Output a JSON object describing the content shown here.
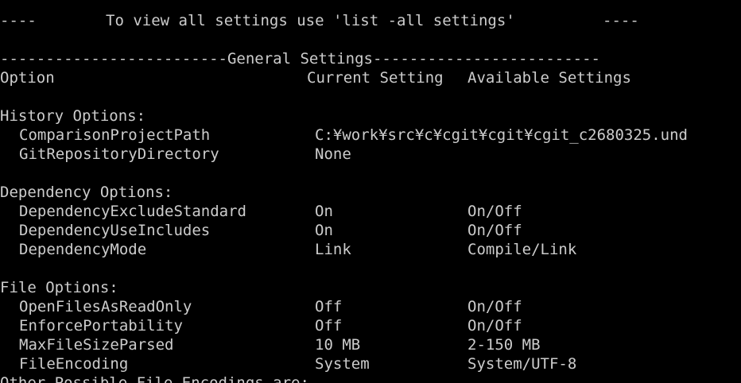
{
  "banner": {
    "left_dashes": "----",
    "message": "To view all settings use 'list -all settings'",
    "right_dashes": "----"
  },
  "section_rule": "-------------------------General Settings-------------------------",
  "columns": {
    "option": "Option",
    "current": "Current Setting",
    "available": "Available Settings"
  },
  "groups": [
    {
      "title": "History Options:",
      "rows": [
        {
          "option": "ComparisonProjectPath",
          "current": "C:¥work¥src¥c¥cgit¥cgit¥cgit_c2680325.und",
          "available": ""
        },
        {
          "option": "GitRepositoryDirectory",
          "current": "None",
          "available": ""
        }
      ]
    },
    {
      "title": "Dependency Options:",
      "rows": [
        {
          "option": "DependencyExcludeStandard",
          "current": "On",
          "available": "On/Off"
        },
        {
          "option": "DependencyUseIncludes",
          "current": "On",
          "available": "On/Off"
        },
        {
          "option": "DependencyMode",
          "current": "Link",
          "available": "Compile/Link"
        }
      ]
    },
    {
      "title": "File Options:",
      "rows": [
        {
          "option": "OpenFilesAsReadOnly",
          "current": "Off",
          "available": "On/Off"
        },
        {
          "option": "EnforcePortability",
          "current": "Off",
          "available": "On/Off"
        },
        {
          "option": "MaxFileSizeParsed",
          "current": "10 MB",
          "available": "2-150 MB"
        },
        {
          "option": "FileEncoding",
          "current": "System",
          "available": "System/UTF-8"
        }
      ]
    }
  ],
  "trailing_line": "Other Possible File Encodings are:",
  "colors": {
    "background": "#000000",
    "text": "#cccccc"
  }
}
